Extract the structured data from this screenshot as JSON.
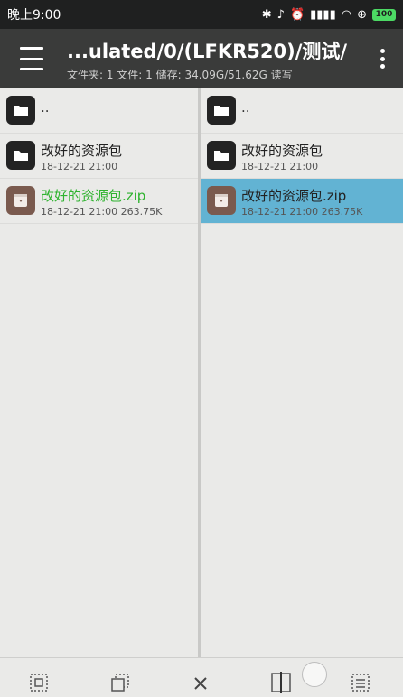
{
  "status_bar": {
    "time": "晚上9:00",
    "battery": "100"
  },
  "toolbar": {
    "title": "...ulated/0/(LFKR520)/测试/",
    "subtitle": "文件夹: 1  文件: 1  储存: 34.09G/51.62G  读写"
  },
  "left_pane": {
    "items": [
      {
        "name": "..",
        "type": "parent"
      },
      {
        "name": "改好的资源包",
        "meta": "18-12-21 21:00",
        "type": "folder"
      },
      {
        "name": "改好的资源包.zip",
        "meta": "18-12-21 21:00   263.75K",
        "type": "zip"
      }
    ]
  },
  "right_pane": {
    "items": [
      {
        "name": "..",
        "type": "parent"
      },
      {
        "name": "改好的资源包",
        "meta": "18-12-21 21:00",
        "type": "folder"
      },
      {
        "name": "改好的资源包.zip",
        "meta": "18-12-21 21:00   263.75K",
        "type": "zip",
        "selected": true
      }
    ]
  },
  "colors": {
    "toolbar": "#3a3b3a",
    "status_bar": "#1f2020",
    "selection": "#62b3d3",
    "highlight_text": "#2fb32f"
  },
  "bottom_bar": {
    "icons": [
      "select-all-icon",
      "paste-icon",
      "close-icon",
      "split-pane-icon",
      "list-icon"
    ]
  }
}
